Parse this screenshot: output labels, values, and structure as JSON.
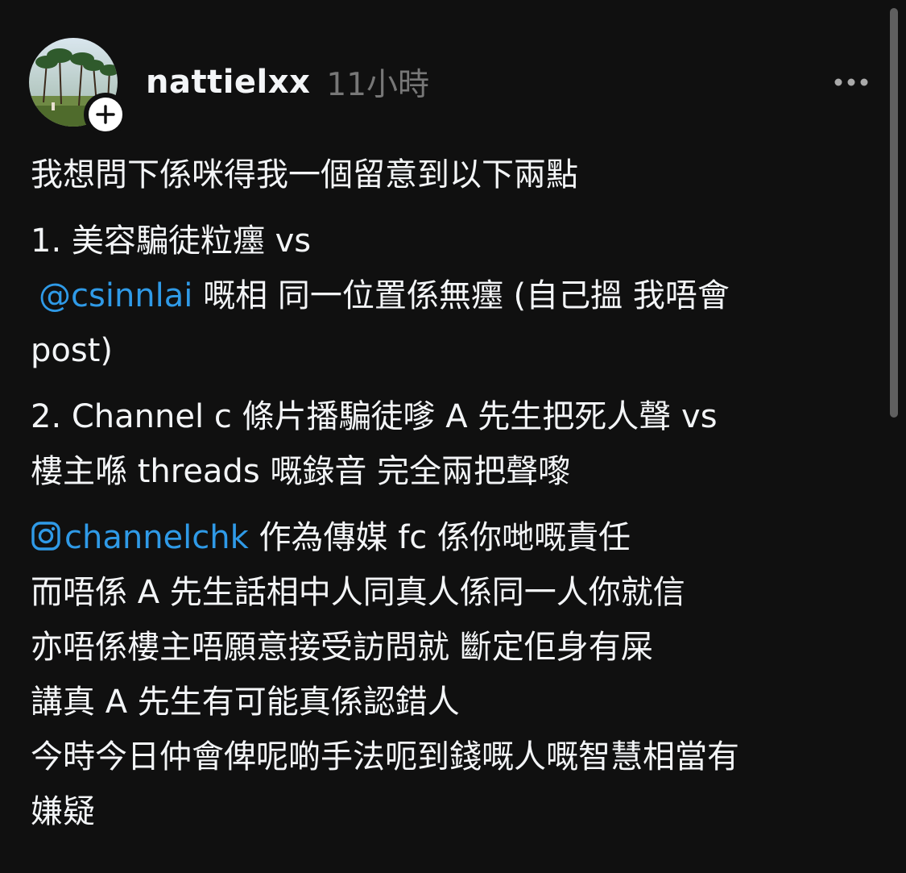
{
  "post": {
    "username": "nattielxx",
    "time": "11小時",
    "icons": {
      "avatar": "avatar-photo",
      "follow": "plus-icon",
      "more": "more-icon",
      "instagram": "instagram-icon"
    },
    "colors": {
      "background": "#101010",
      "text": "#f3f5f7",
      "muted": "#777777",
      "mention": "#2f9ae7"
    },
    "lines": {
      "l1": "我想問下係咪得我一個留意到以下兩點",
      "l2": "1. 美容騙徒粒癦 vs",
      "l3_mention": "@csinnlai",
      "l3_rest": " 嘅相 同一位置係無癦 (自己搵 我唔會",
      "l4": "post)",
      "l5": "2. Channel c 條片播騙徒嗲 A 先生把死人聲 vs",
      "l6": "樓主喺 threads 嘅錄音 完全兩把聲嚟",
      "l7_mention": "channelchk",
      "l7_rest": " 作為傳媒 fc 係你哋嘅責任",
      "l8": "而唔係 A 先生話相中人同真人係同一人你就信",
      "l9": "亦唔係樓主唔願意接受訪問就  斷定佢身有屎",
      "l10": "講真 A 先生有可能真係認錯人",
      "l11": "今時今日仲會俾呢啲手法呃到錢嘅人嘅智慧相當有",
      "l12": "嫌疑"
    }
  }
}
